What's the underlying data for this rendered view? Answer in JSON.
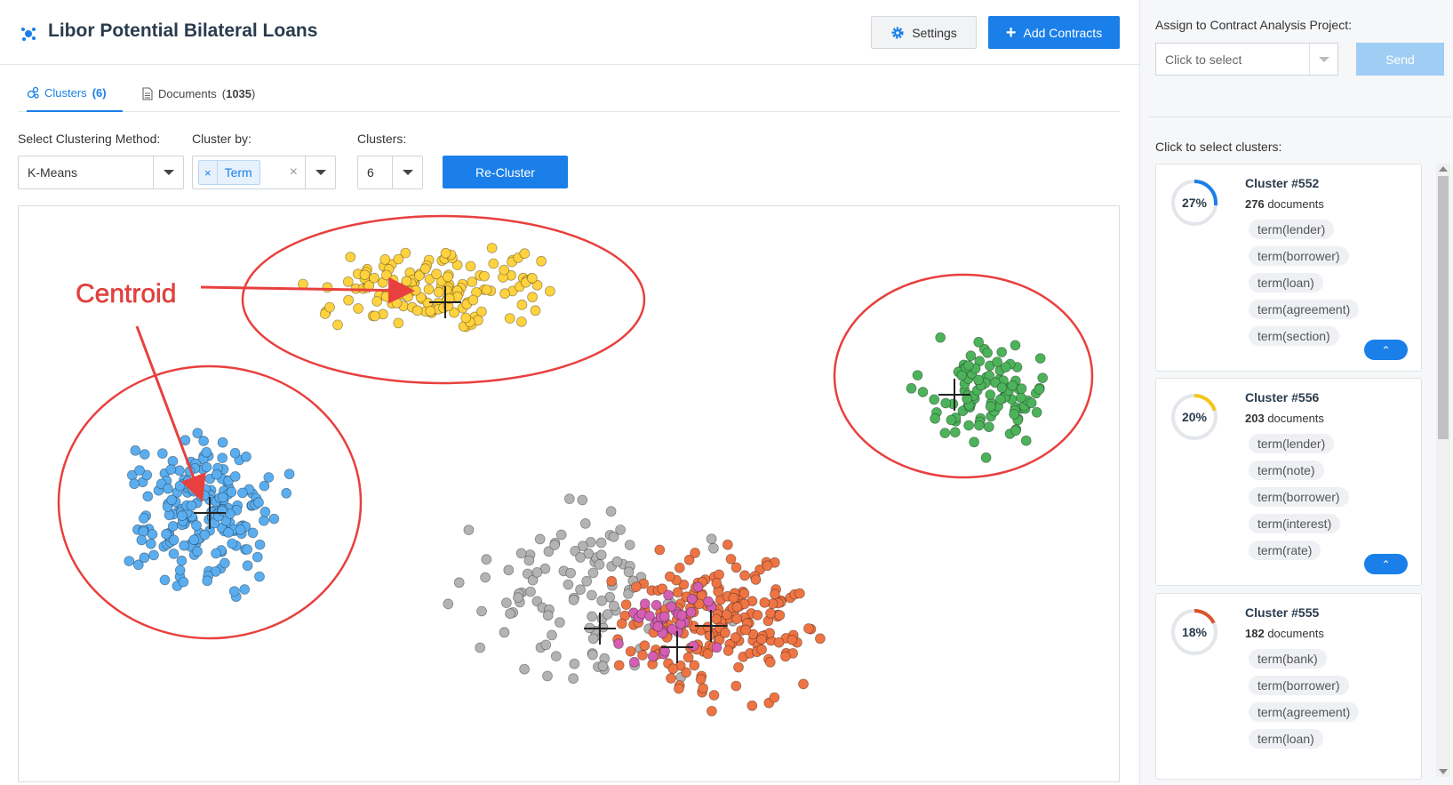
{
  "header": {
    "title": "Libor Potential Bilateral Loans",
    "settings_label": "Settings",
    "add_contracts_label": "Add Contracts"
  },
  "tabs": [
    {
      "label": "Clusters",
      "count": "(6)"
    },
    {
      "label": "Documents",
      "count": "1035"
    }
  ],
  "controls": {
    "method_label": "Select Clustering Method:",
    "method_value": "K-Means",
    "cluster_by_label": "Cluster by:",
    "cluster_by_chip": "Term",
    "clusters_label": "Clusters:",
    "clusters_value": "6",
    "recluster_label": "Re-Cluster"
  },
  "annotation": {
    "centroid_label": "Centroid"
  },
  "panel": {
    "assign_label": "Assign to Contract Analysis Project:",
    "select_placeholder": "Click to select",
    "send_label": "Send",
    "click_label": "Click to select clusters:",
    "cards": [
      {
        "name": "Cluster #552",
        "docs": "276",
        "docs_suffix": " documents",
        "pct": "27%",
        "pct_value": 0.27,
        "color": "#1a7fe8",
        "terms": [
          "term(lender)",
          "term(borrower)",
          "term(loan)",
          "term(agreement)",
          "term(section)"
        ]
      },
      {
        "name": "Cluster #556",
        "docs": "203",
        "docs_suffix": " documents",
        "pct": "20%",
        "pct_value": 0.2,
        "color": "#f5c518",
        "terms": [
          "term(lender)",
          "term(note)",
          "term(borrower)",
          "term(interest)",
          "term(rate)"
        ]
      },
      {
        "name": "Cluster #555",
        "docs": "182",
        "docs_suffix": " documents",
        "pct": "18%",
        "pct_value": 0.18,
        "color": "#d9542c",
        "terms": [
          "term(bank)",
          "term(borrower)",
          "term(agreement)",
          "term(loan)"
        ]
      }
    ]
  },
  "chart_data": {
    "type": "scatter",
    "series": [
      {
        "color": "#5aaef0",
        "values": []
      },
      {
        "color": "#ffd23f",
        "values": []
      },
      {
        "color": "#4db35b",
        "values": []
      },
      {
        "color": "#b3b3b3",
        "values": []
      },
      {
        "color": "#ef7443",
        "values": []
      },
      {
        "color": "#d45fb2",
        "values": []
      }
    ],
    "grid": false
  }
}
